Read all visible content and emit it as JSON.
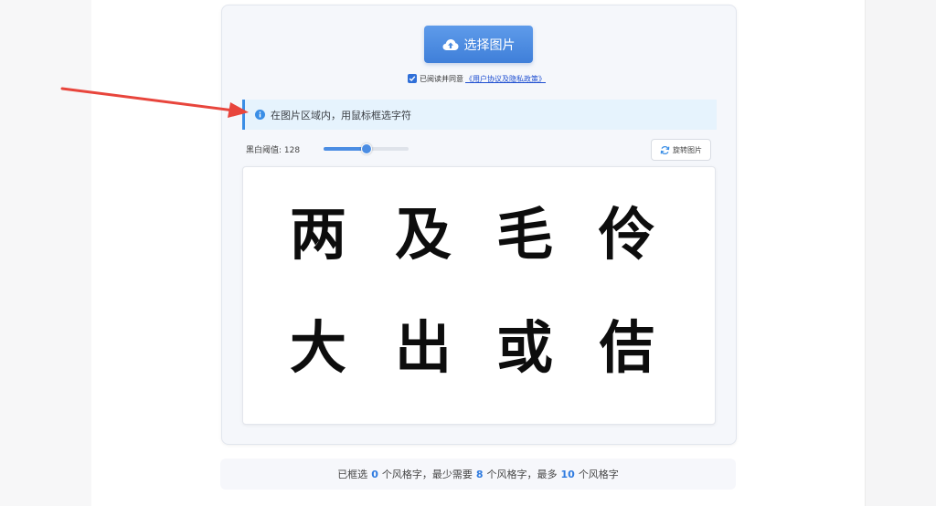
{
  "upload": {
    "label": "选择图片",
    "icon": "cloud-upload-icon"
  },
  "agreement": {
    "checked": true,
    "text": "已阅读并同意",
    "link": "《用户协议及隐私政策》"
  },
  "tip": {
    "icon": "info-icon",
    "text": "在图片区域内，用鼠标框选字符"
  },
  "threshold": {
    "label": "黑白阈值: 128",
    "value": 128,
    "max": 255
  },
  "rotate": {
    "label": "旋转图片",
    "icon": "rotate-icon"
  },
  "image": {
    "characters": [
      "两",
      "及",
      "毛",
      "伶",
      "大",
      "出",
      "或",
      "佶"
    ]
  },
  "status": {
    "part1": "已框选",
    "selected": "0",
    "part2": "个风格字，最少需要",
    "min": "8",
    "part3": "个风格字，最多",
    "max": "10",
    "part4": "个风格字"
  },
  "colors": {
    "accent": "#3f7fd9",
    "annotation_arrow": "#e8453c"
  }
}
